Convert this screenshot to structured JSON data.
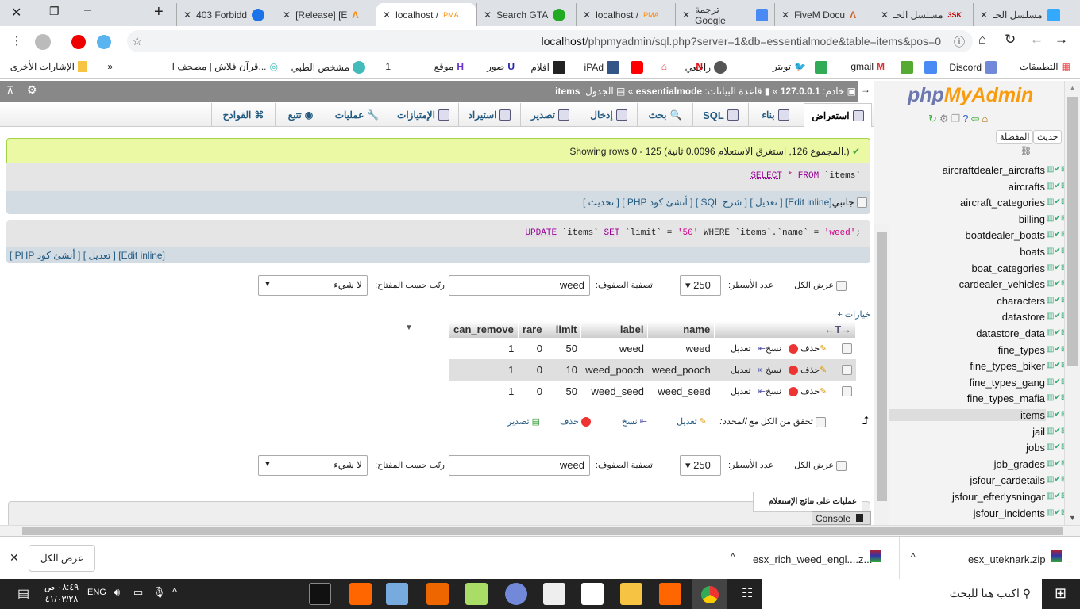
{
  "browser": {
    "tabs": [
      {
        "title": "403 Forbidd",
        "icon": "blue-loop-icon"
      },
      {
        "title": "[Release] [E",
        "icon": "orange-a-icon"
      },
      {
        "title": "localhost /",
        "icon": "pma-icon",
        "active": true
      },
      {
        "title": "Search GTA",
        "icon": "green-5-icon"
      },
      {
        "title": "localhost /",
        "icon": "pma-icon"
      },
      {
        "title": "ترجمة Google",
        "icon": "google-translate-icon"
      },
      {
        "title": "FiveM Docu",
        "icon": "fivem-icon"
      },
      {
        "title": "مسلسل الحـ",
        "icon": "3sk-icon"
      },
      {
        "title": "مسلسل الحـ",
        "icon": "blue-tv-icon"
      }
    ],
    "url_host": "localhost",
    "url_rest": "/phpmyadmin/sql.php?server=1&db=essentialmode&table=items&pos=0",
    "bookmarks": [
      "التطبيقات",
      "Discord",
      "",
      "gmail",
      "",
      "تويتر",
      "راجعي",
      "",
      "",
      "iPAd",
      "افلام",
      "صور",
      "موقع",
      "1",
      "مشخص الطبي",
      "قرآن فلاش | مصحف ا...",
      "»",
      "الإشارات الأخرى"
    ]
  },
  "pma": {
    "breadcrumb": {
      "server_label": "خادم:",
      "server": "127.0.0.1",
      "db_label": "قاعدة البيانات:",
      "db": "essentialmode",
      "table_label": "الجدول:",
      "table": "items"
    },
    "tabs": [
      "استعراض",
      "بناء",
      "SQL",
      "بحث",
      "إدخال",
      "تصدير",
      "استيراد",
      "الإمتيازات",
      "عمليات",
      "تتبع",
      "القوادح"
    ],
    "success": "Showing rows 0 - 125 (المجموع 126, استغرق الاستعلام 0.0096 ثانية.)",
    "query1": {
      "kw1": "SELECT",
      "star": "*",
      "kw2": "FROM",
      "rest": "`items`"
    },
    "links1": {
      "profiling": "جانبي",
      "edit_inline": "[Edit inline]",
      "edit": "[ تعديل ]",
      "explain": "[ شرح SQL ]",
      "php": "[ أنشئ كود PHP ]",
      "refresh": "[ تحديث ]"
    },
    "query2": {
      "kw1": "UPDATE",
      "t": "`items`",
      "kw2": "SET",
      "rest": "`limit` = ",
      "v": "'50'",
      "rest2": " WHERE `items`.`name` = ",
      "v2": "'weed'",
      "end": ";"
    },
    "links2": {
      "edit_inline": "[Edit inline]",
      "edit": "[ تعديل ]",
      "php": "[ أنشئ كود PHP ]"
    },
    "nav": {
      "show_all": "عرض الكل",
      "rows_label": "عدد الأسطر:",
      "rows": "250",
      "filter_label": "تصفية الصفوف:",
      "filter": "weed",
      "sort_label": "رتّب حسب المفتاح:",
      "sort": "لا شيء"
    },
    "options": "+ خيارات",
    "columns": [
      "name",
      "label",
      "limit",
      "rare",
      "can_remove"
    ],
    "rows": [
      [
        "weed",
        "weed",
        "50",
        "0",
        "1"
      ],
      [
        "weed_pooch",
        "weed_pooch",
        "10",
        "0",
        "1"
      ],
      [
        "weed_seed",
        "weed_seed",
        "50",
        "0",
        "1"
      ]
    ],
    "row_actions": {
      "edit": "تعديل",
      "copy": "نسخ",
      "delete": "حذف"
    },
    "with_selected": {
      "check_all": "تحقق من الكل",
      "label": "مع المحدد:",
      "edit": "تعديل",
      "copy": "نسخ",
      "delete": "حذف",
      "export": "تصدير"
    },
    "query_ops_tooltip": "عمليات على نتائج الإستعلام",
    "console": "Console",
    "sidebar": {
      "logo": "phpMyAdmin",
      "recent": "حديث",
      "favorites": "المفضلة",
      "tables": [
        "aircraftdealer_aircrafts",
        "aircrafts",
        "aircraft_categories",
        "billing",
        "boatdealer_boats",
        "boats",
        "boat_categories",
        "cardealer_vehicles",
        "characters",
        "datastore",
        "datastore_data",
        "fine_types",
        "fine_types_biker",
        "fine_types_gang",
        "fine_types_mafia",
        "items",
        "jail",
        "jobs",
        "job_grades",
        "jsfour_cardetails",
        "jsfour_efterlysningar",
        "jsfour_incidents"
      ],
      "selected": "items"
    }
  },
  "downloads": {
    "show_all": "عرض الكل",
    "files": [
      "esx_rich_weed_engl....z...",
      "esx_uteknark.zip"
    ]
  },
  "taskbar": {
    "search": "اكتب هنا للبحث",
    "lang": "ENG",
    "time": "٠٨:٤٩ ص",
    "date": "٤١/٠٣/٢٨"
  },
  "colors": {
    "accent": "#235a81",
    "success_bg": "#ebf8a4",
    "pma_orange": "#f89c0e",
    "pma_blue": "#6c78af"
  }
}
